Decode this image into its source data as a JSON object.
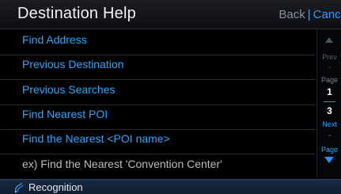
{
  "header": {
    "title": "Destination Help",
    "back_label": "Back",
    "separator": "|",
    "cancel_label": "Cance"
  },
  "list": {
    "items": [
      {
        "label": "Find Address"
      },
      {
        "label": "Previous Destination"
      },
      {
        "label": "Previous Searches"
      },
      {
        "label": "Find Nearest POI"
      },
      {
        "label": "Find the Nearest <POI name>"
      },
      {
        "label": "ex) Find the Nearest 'Convention Center'"
      }
    ]
  },
  "pager": {
    "prev_label": "Prev",
    "dash": "-",
    "page_label": "Page",
    "current_page": "1",
    "total_pages": "3",
    "next_label": "Next",
    "page2_label": "Page"
  },
  "status": {
    "icon": "voice-recognition-icon",
    "label": "Recognition"
  },
  "colors": {
    "accent": "#2fa6ff",
    "background": "#000000",
    "status_bar": "#1a2b44"
  }
}
